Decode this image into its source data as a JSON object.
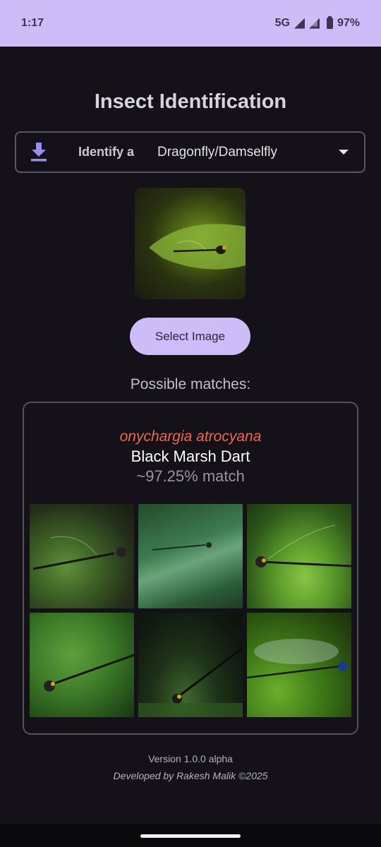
{
  "status": {
    "time": "1:17",
    "network": "5G",
    "battery": "97%"
  },
  "title": "Insect Identification",
  "selector": {
    "icon": "download-icon",
    "label": "Identify a",
    "value": "Dragonfly/Damselfly"
  },
  "select_button_label": "Select Image",
  "matches_label": "Possible matches:",
  "match": {
    "scientific_name": "onychargia atrocyana",
    "common_name": "Black Marsh Dart",
    "confidence": "~97.25% match",
    "thumbnails": [
      "damselfly-photo-1",
      "damselfly-photo-2",
      "damselfly-photo-3",
      "damselfly-photo-4",
      "damselfly-photo-5",
      "damselfly-photo-6"
    ]
  },
  "footer": {
    "version": "Version 1.0.0 alpha",
    "developer": "Developed by Rakesh Malik ©2025"
  },
  "colors": {
    "accent": "#cdbcf7",
    "background": "#141218",
    "scientific_name": "#e66a52"
  }
}
